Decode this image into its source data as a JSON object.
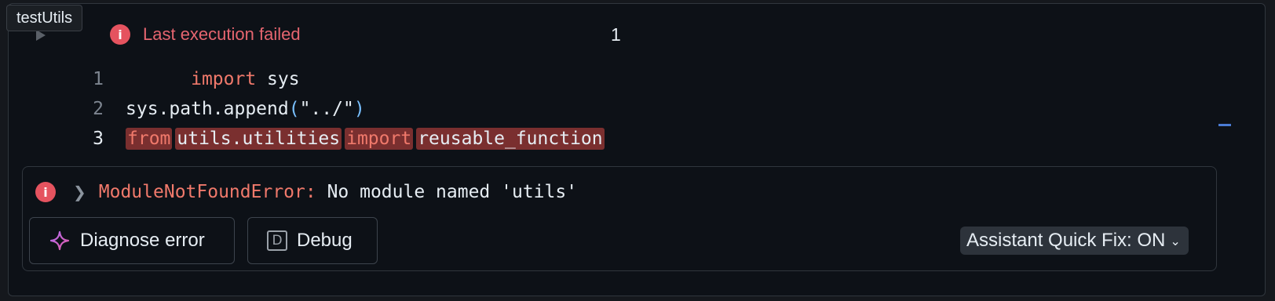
{
  "tooltip": {
    "text": "testUtils"
  },
  "cell": {
    "status_text": "Last execution failed",
    "execution_count": "1",
    "code_lines": [
      {
        "number": "1",
        "tokens": [
          {
            "kw": "import"
          },
          {
            "text": " sys"
          }
        ]
      },
      {
        "number": "2",
        "text_a": "sys.path.append",
        "paren_open": "(",
        "string": "\"../\"",
        "paren_close": ")"
      },
      {
        "number": "3",
        "kw_from": "from",
        "module": "utils.utilities",
        "kw_import": "import",
        "name": "reusable_function"
      }
    ]
  },
  "line1": {
    "number": "1",
    "kw": "import",
    "rest": "sys"
  },
  "line2": {
    "number": "2",
    "text": "sys.path.append",
    "paren_open": "(",
    "string": "\"../\"",
    "paren_close": ")"
  },
  "line3": {
    "number": "3",
    "kw_from": "from",
    "module": "utils.utilities",
    "kw_import": "import",
    "name": "reusable_function"
  },
  "error": {
    "type": "ModuleNotFoundError:",
    "message": " No module named 'utils'",
    "diagnose_label": "Diagnose error",
    "debug_label": "Debug",
    "debug_icon_letter": "D",
    "quickfix_label": "Assistant Quick Fix: ON"
  },
  "icons": {
    "info": "info-icon",
    "run": "play-icon",
    "expand": "chevron-right-icon",
    "sparkle": "sparkle-icon",
    "debug": "debug-icon",
    "dropdown": "chevron-down-icon"
  },
  "colors": {
    "error_red": "#e5535f",
    "keyword": "#f0796b",
    "highlight": "#7a2f2f"
  }
}
